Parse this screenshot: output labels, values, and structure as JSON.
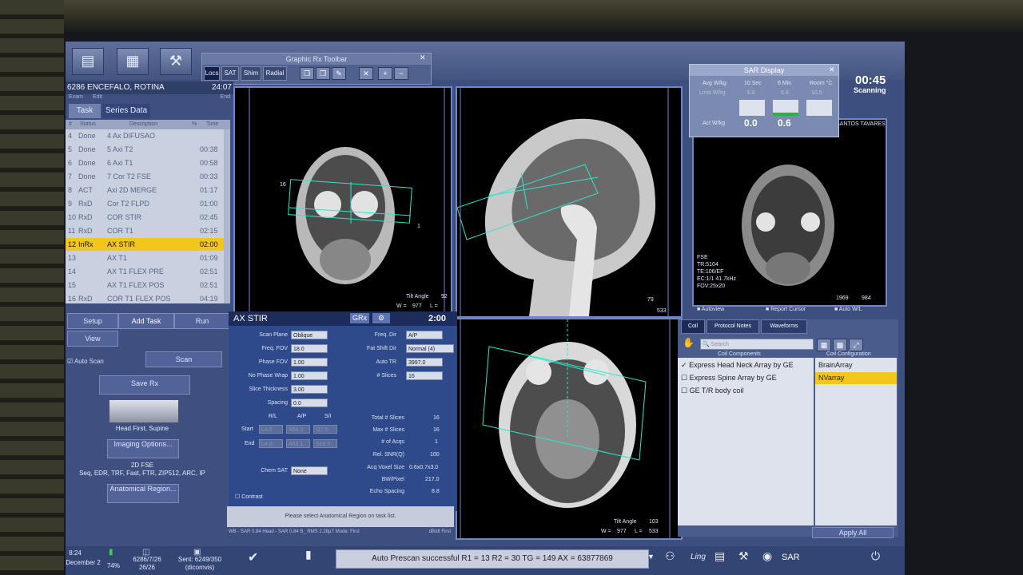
{
  "toolbar": {
    "graphic_rx_title": "Graphic Rx Toolbar",
    "tabs": [
      "Locs",
      "SAT",
      "Shim",
      "Radial"
    ]
  },
  "patient": {
    "name": "6286 ENCEFALO, ROTINA",
    "time": "24:07",
    "menu": [
      "Exam",
      "Edit"
    ],
    "end_label": "End"
  },
  "tasks": {
    "tabs": [
      "Task",
      "Series Data"
    ],
    "headers": [
      "#",
      "Status",
      "Description",
      "%",
      "Time"
    ],
    "rows": [
      {
        "num": "4",
        "status": "Done",
        "desc": "4 Ax DIFUSAO",
        "time": "",
        "selected": false
      },
      {
        "num": "5",
        "status": "Done",
        "desc": "5 Axi T2",
        "time": "00:38",
        "selected": false
      },
      {
        "num": "6",
        "status": "Done",
        "desc": "6 Axi T1",
        "time": "00:58",
        "selected": false
      },
      {
        "num": "7",
        "status": "Done",
        "desc": "7 Cor T2 FSE",
        "time": "00:33",
        "selected": false
      },
      {
        "num": "8",
        "status": "ACT",
        "desc": "Axi 2D MERGE",
        "time": "01:17",
        "selected": false
      },
      {
        "num": "9",
        "status": "RxD",
        "desc": "Cor T2 FLPD",
        "time": "01:00",
        "selected": false
      },
      {
        "num": "10",
        "status": "RxD",
        "desc": "COR STIR",
        "time": "02:45",
        "selected": false
      },
      {
        "num": "11",
        "status": "RxD",
        "desc": "COR T1",
        "time": "02:15",
        "selected": false
      },
      {
        "num": "12",
        "status": "InRx",
        "desc": "AX STIR",
        "time": "02:00",
        "selected": true
      },
      {
        "num": "13",
        "status": "",
        "desc": "AX T1",
        "time": "01:09",
        "selected": false
      },
      {
        "num": "14",
        "status": "",
        "desc": "AX T1 FLEX PRE",
        "time": "02:51",
        "selected": false
      },
      {
        "num": "15",
        "status": "",
        "desc": "AX T1 FLEX POS",
        "time": "02:51",
        "selected": false
      },
      {
        "num": "16",
        "status": "RxD",
        "desc": "COR T1 FLEX POS",
        "time": "04:19",
        "selected": false
      }
    ],
    "buttons": {
      "setup": "Setup",
      "add_task": "Add Task",
      "run": "Run",
      "view": "View",
      "scan": "Scan"
    },
    "auto_scan": "Auto Scan"
  },
  "scan_setup": {
    "save_label": "Save Rx",
    "position": "Head First, Supine",
    "imaging_options": "Imaging Options...",
    "seq_line1": "2D FSE",
    "seq_line2": "Seq, EDR, TRF, Fast, FTR, ZIP512, ARC, IP",
    "anat_region": "Anatomical Region..."
  },
  "viewports": {
    "coronal": {
      "tilt": "Tilt Angle",
      "tilt_val": "92",
      "w": "W =",
      "w_val": "977",
      "l": "L =",
      "label_16": "16",
      "label_1": "1"
    },
    "sagittal": {
      "w_val": "79",
      "l_val": "533"
    },
    "axial": {
      "tilt": "Tilt Angle",
      "tilt_val": "103",
      "w": "W =",
      "w_val": "977",
      "l": "L =",
      "l_val": "533"
    },
    "prev": {
      "patient": "SANTOS TAVARES",
      "info_lines": [
        "FSE",
        "TR:5104",
        "TE:106/EF",
        "EC:1/1 41.7kHz",
        "FOV:25x20"
      ],
      "w_val": "1969",
      "l_val": "984"
    }
  },
  "params": {
    "title": "AX STIR",
    "grx": "GRx",
    "time": "2:00",
    "scan_plane": {
      "label": "Scan Plane",
      "value": "Oblique"
    },
    "freq_fov": {
      "label": "Freq. FOV",
      "value": "18.0"
    },
    "phase_fov": {
      "label": "Phase FOV",
      "value": "1.00"
    },
    "no_phase_wrap": {
      "label": "No Phase Wrap",
      "value": "1.00"
    },
    "slice_thickness": {
      "label": "Slice Thickness",
      "value": "3.00"
    },
    "spacing": {
      "label": "Spacing",
      "value": "0.0"
    },
    "rl_ap_si": [
      "R/L",
      "A/P",
      "S/I"
    ],
    "start": {
      "label": "Start",
      "values": [
        "L4.0",
        "A58.3",
        "I17.5"
      ]
    },
    "end": {
      "label": "End",
      "values": [
        "L4.0",
        "A63.1",
        "S16.0"
      ]
    },
    "freq_dir": {
      "label": "Freq. Dir",
      "value": "A/P"
    },
    "fat_shift": {
      "label": "Fat Shift Dir",
      "value": "Normal (4)"
    },
    "auto_tr": {
      "label": "Auto TR",
      "value": "3997.0"
    },
    "slices": {
      "label": "# Slices",
      "value": "16"
    },
    "total_slices": {
      "label": "Total # Slices",
      "value": "16"
    },
    "max_slices": {
      "label": "Max # Slices",
      "value": "16"
    },
    "acqs": {
      "label": "# of Acqs",
      "value": "1"
    },
    "snr": {
      "label": "Rel. SNR(Q)",
      "value": "100"
    },
    "voxel": {
      "label": "Acq Voxel Size",
      "value": "0.6x0.7x3.0"
    },
    "bw": {
      "label": "BW/Pixel",
      "value": "217.0"
    },
    "echo_spacing": {
      "label": "Echo Spacing",
      "value": "8.8"
    },
    "chem_sat": {
      "label": "Chem SAT",
      "value": "None"
    },
    "contrast": "Contrast",
    "message": "Please select Anatomical Region on task list.",
    "status_line": "WB - SAR 0.84  Head - SAR 0.84 B_ RMS 2.28µT  Mode: First",
    "db": "dB/dt First"
  },
  "sar": {
    "title": "SAR Display",
    "cols": [
      "Avg W/kg",
      "10 Sec",
      "6 Min",
      "Room °C"
    ],
    "limit": "Limit W/kg",
    "limit_vals": [
      "6.8",
      "6.8",
      "10.5"
    ],
    "act": "Act W/kg",
    "act_vals": [
      "0.0",
      "0.6"
    ]
  },
  "scan_clock": {
    "time": "00:45",
    "state": "Scanning"
  },
  "coil": {
    "tabs": [
      "Coil",
      "Protocol Notes",
      "Waveforms"
    ],
    "search_placeholder": "Search",
    "components_header": "Coil Components",
    "config_header": "Coil Configuration",
    "items": [
      {
        "name": "Express Head Neck Array by GE",
        "checked": true
      },
      {
        "name": "Express Spine Array by GE",
        "checked": false
      },
      {
        "name": "GE T/R body coil",
        "checked": false
      }
    ],
    "configs": [
      {
        "name": "BrainArray",
        "selected": false
      },
      {
        "name": "NVarray",
        "selected": true
      }
    ],
    "apply_all": "Apply All",
    "checkboxes": [
      "Autoview",
      "Report Cursor",
      "Auto W/L"
    ]
  },
  "status_bar": {
    "time": "8:24",
    "date": "December 2",
    "disk": "74%",
    "exam": "6286/7/26",
    "exam_sub": "26/26",
    "sent": "Sent: 6249/350",
    "sent_sub": "(dicomvis)",
    "prescan": "Auto Prescan successful  R1 = 13 R2 = 30 TG = 149 AX = 63877869",
    "sar": "SAR"
  }
}
